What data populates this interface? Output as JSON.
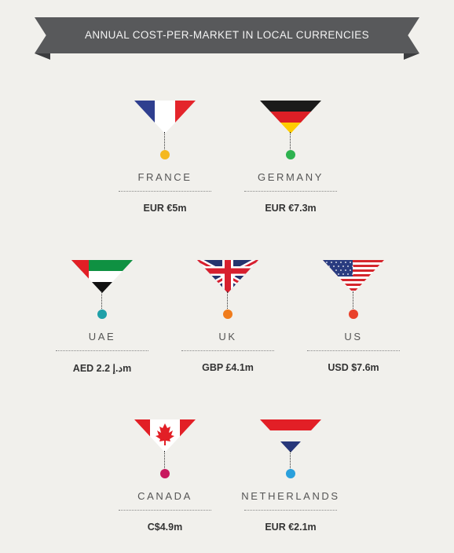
{
  "title": "ANNUAL COST-PER-MARKET IN LOCAL CURRENCIES",
  "chart_data": {
    "type": "table",
    "title": "ANNUAL COST-PER-MARKET IN LOCAL CURRENCIES",
    "markets": [
      {
        "country": "FRANCE",
        "cost_label": "EUR €5m",
        "currency": "EUR",
        "value_m": 5,
        "flag": "france-flag-icon",
        "dot_color": "#f5b81f"
      },
      {
        "country": "GERMANY",
        "cost_label": "EUR €7.3m",
        "currency": "EUR",
        "value_m": 7.3,
        "flag": "germany-flag-icon",
        "dot_color": "#2eb24f"
      },
      {
        "country": "UAE",
        "cost_label": "AED د.إ 2.2m",
        "currency": "AED",
        "value_m": 2.2,
        "flag": "uae-flag-icon",
        "dot_color": "#1fa0a8"
      },
      {
        "country": "UK",
        "cost_label": "GBP £4.1m",
        "currency": "GBP",
        "value_m": 4.1,
        "flag": "uk-flag-icon",
        "dot_color": "#f07c1c"
      },
      {
        "country": "US",
        "cost_label": "USD $7.6m",
        "currency": "USD",
        "value_m": 7.6,
        "flag": "us-flag-icon",
        "dot_color": "#e9412b"
      },
      {
        "country": "CANADA",
        "cost_label": "C$4.9m",
        "currency": "CAD",
        "value_m": 4.9,
        "flag": "canada-flag-icon",
        "dot_color": "#c8195e"
      },
      {
        "country": "NETHERLANDS",
        "cost_label": "EUR €2.1m",
        "currency": "EUR",
        "value_m": 2.1,
        "flag": "netherlands-flag-icon",
        "dot_color": "#2aa0dc"
      }
    ]
  }
}
